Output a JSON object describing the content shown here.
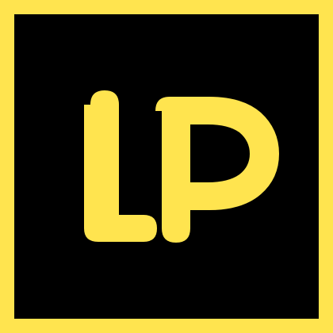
{
  "logo": {
    "text": "LP",
    "colors": {
      "frame": "#ffe44f",
      "background": "#000000",
      "letters": "#ffe44f"
    }
  }
}
